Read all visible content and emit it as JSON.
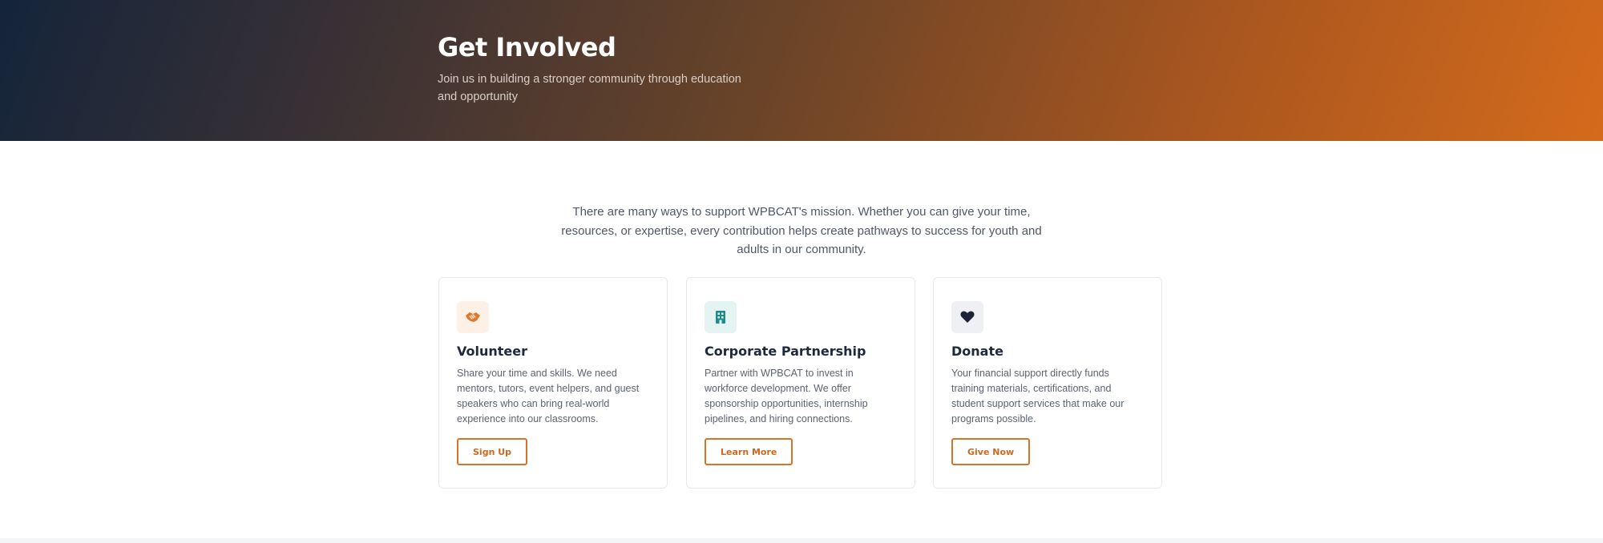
{
  "hero": {
    "title": "Get Involved",
    "subtitle": "Join us in building a stronger community through education and opportunity"
  },
  "intro": {
    "text": "There are many ways to support WPBCAT's mission. Whether you can give your time, resources, or expertise, every contribution helps create pathways to success for youth and adults in our community."
  },
  "cards": [
    {
      "icon": "handshake-icon",
      "icon_color": "#e0782a",
      "title": "Volunteer",
      "text": "Share your time and skills. We need mentors, tutors, event helpers, and guest speakers who can bring real-world experience into our classrooms.",
      "button": "Sign Up"
    },
    {
      "icon": "building-icon",
      "icon_color": "#1f8a8a",
      "title": "Corporate Partnership",
      "text": "Partner with WPBCAT to invest in workforce development. We offer sponsorship opportunities, internship pipelines, and hiring connections.",
      "button": "Learn More"
    },
    {
      "icon": "heart-icon",
      "icon_color": "#1b2438",
      "title": "Donate",
      "text": "Your financial support directly funds training materials, certifications, and student support services that make our programs possible.",
      "button": "Give Now"
    }
  ],
  "colors": {
    "accent": "#d97326",
    "heading": "#1e2a3b",
    "body_text": "#5a6373"
  }
}
